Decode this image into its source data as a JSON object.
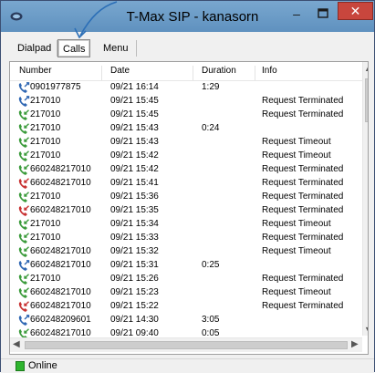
{
  "window": {
    "title": "T-Max SIP - kanasorn",
    "minimize_glyph": "–",
    "maximize_glyph": "□",
    "close_glyph": "✕"
  },
  "tabs": [
    {
      "label": "Dialpad"
    },
    {
      "label": "Calls"
    },
    {
      "label": "Menu"
    }
  ],
  "table": {
    "headers": [
      "Number",
      "Date",
      "Duration",
      "Info"
    ],
    "rows": [
      {
        "type": "outgoing",
        "number": "0901977875",
        "date": "09/21 16:14",
        "duration": "1:29",
        "info": ""
      },
      {
        "type": "outgoing",
        "number": "217010",
        "date": "09/21 15:45",
        "duration": "",
        "info": "Request Terminated"
      },
      {
        "type": "incoming",
        "number": "217010",
        "date": "09/21 15:45",
        "duration": "",
        "info": "Request Terminated"
      },
      {
        "type": "incoming",
        "number": "217010",
        "date": "09/21 15:43",
        "duration": "0:24",
        "info": ""
      },
      {
        "type": "incoming",
        "number": "217010",
        "date": "09/21 15:43",
        "duration": "",
        "info": "Request Timeout"
      },
      {
        "type": "incoming",
        "number": "217010",
        "date": "09/21 15:42",
        "duration": "",
        "info": "Request Timeout"
      },
      {
        "type": "incoming",
        "number": "660248217010",
        "date": "09/21 15:42",
        "duration": "",
        "info": "Request Terminated"
      },
      {
        "type": "missed",
        "number": "660248217010",
        "date": "09/21 15:41",
        "duration": "",
        "info": "Request Terminated"
      },
      {
        "type": "incoming",
        "number": "217010",
        "date": "09/21 15:36",
        "duration": "",
        "info": "Request Terminated"
      },
      {
        "type": "missed",
        "number": "660248217010",
        "date": "09/21 15:35",
        "duration": "",
        "info": "Request Terminated"
      },
      {
        "type": "incoming",
        "number": "217010",
        "date": "09/21 15:34",
        "duration": "",
        "info": "Request Timeout"
      },
      {
        "type": "incoming",
        "number": "217010",
        "date": "09/21 15:33",
        "duration": "",
        "info": "Request Terminated"
      },
      {
        "type": "incoming",
        "number": "660248217010",
        "date": "09/21 15:32",
        "duration": "",
        "info": "Request Timeout"
      },
      {
        "type": "outgoing",
        "number": "660248217010",
        "date": "09/21 15:31",
        "duration": "0:25",
        "info": ""
      },
      {
        "type": "incoming",
        "number": "217010",
        "date": "09/21 15:26",
        "duration": "",
        "info": "Request Terminated"
      },
      {
        "type": "incoming",
        "number": "660248217010",
        "date": "09/21 15:23",
        "duration": "",
        "info": "Request Timeout"
      },
      {
        "type": "missed",
        "number": "660248217010",
        "date": "09/21 15:22",
        "duration": "",
        "info": "Request Terminated"
      },
      {
        "type": "outgoing",
        "number": "660248209601",
        "date": "09/21 14:30",
        "duration": "3:05",
        "info": ""
      },
      {
        "type": "incoming",
        "number": "660248217010",
        "date": "09/21 09:40",
        "duration": "0:05",
        "info": ""
      }
    ]
  },
  "icons": {
    "outgoing": "phone-outgoing-icon",
    "incoming": "phone-incoming-icon",
    "missed": "phone-missed-icon"
  },
  "colors": {
    "outgoing": "#2f67b3",
    "incoming": "#3b9b3b",
    "missed": "#c83232",
    "titlebar": "#6d9dc8",
    "close_button": "#c8463d",
    "status_online": "#2fb52f"
  },
  "scroll": {
    "up": "▲",
    "down": "▼",
    "left": "◀",
    "right": "▶"
  },
  "status": {
    "text": "Online"
  }
}
